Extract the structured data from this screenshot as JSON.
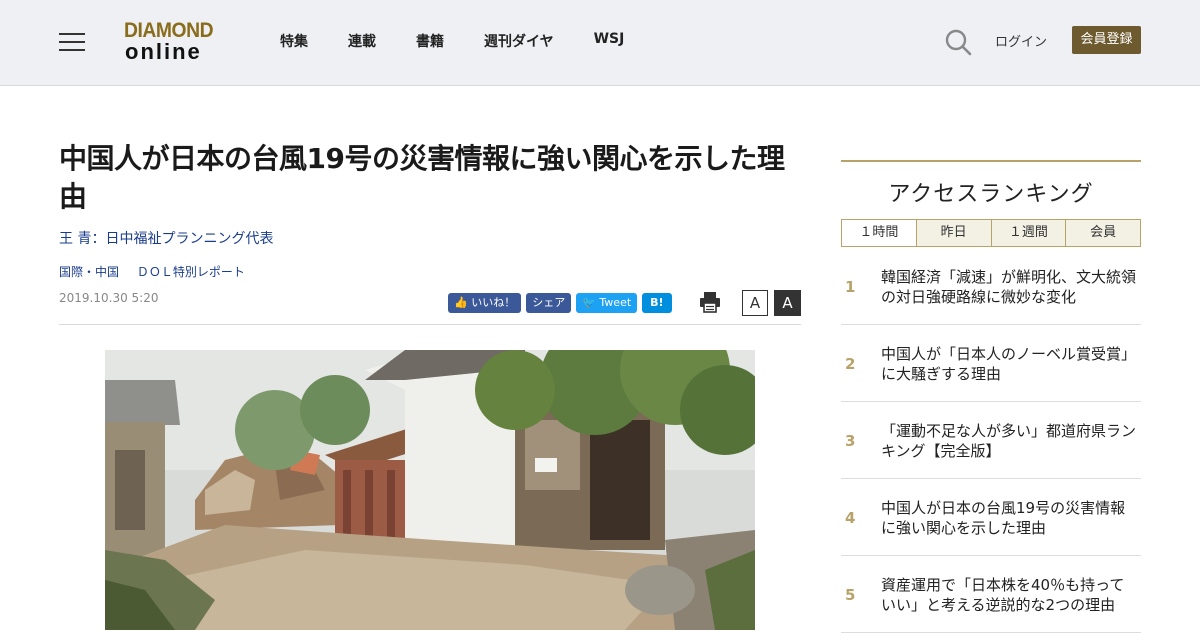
{
  "header": {
    "logo_top": "DIAMOND",
    "logo_bottom": "online",
    "nav": [
      "特集",
      "連載",
      "書籍",
      "週刊ダイヤ",
      "WSJ"
    ],
    "login": "ログイン",
    "register": "会員登録",
    "colors": {
      "brand": "#8a6d1c",
      "register_bg": "#6d5a2e"
    }
  },
  "article": {
    "title": "中国人が日本の台風19号の災害情報に強い関心を示した理由",
    "author": "王 青：日中福祉プランニング代表",
    "categories": [
      "国際・中国",
      "ＤＯＬ特別レポート"
    ],
    "date": "2019.10.30 5:20",
    "social": {
      "like": "いいね！",
      "share": "シェア",
      "tweet": "Tweet",
      "hatena": "B!"
    },
    "font_small": "A",
    "font_large": "A"
  },
  "ranking": {
    "title": "アクセスランキング",
    "tabs": [
      "１時間",
      "昨日",
      "１週間",
      "会員"
    ],
    "items": [
      {
        "rank": "1",
        "text": "韓国経済「減速」が鮮明化、文大統領の対日強硬路線に微妙な変化"
      },
      {
        "rank": "2",
        "text": "中国人が「日本人のノーベル賞受賞」に大騒ぎする理由"
      },
      {
        "rank": "3",
        "text": "「運動不足な人が多い」都道府県ランキング【完全版】"
      },
      {
        "rank": "4",
        "text": "中国人が日本の台風19号の災害情報に強い関心を示した理由"
      },
      {
        "rank": "5",
        "text": "資産運用で「日本株を40％も持っていい」と考える逆説的な2つの理由"
      }
    ]
  }
}
